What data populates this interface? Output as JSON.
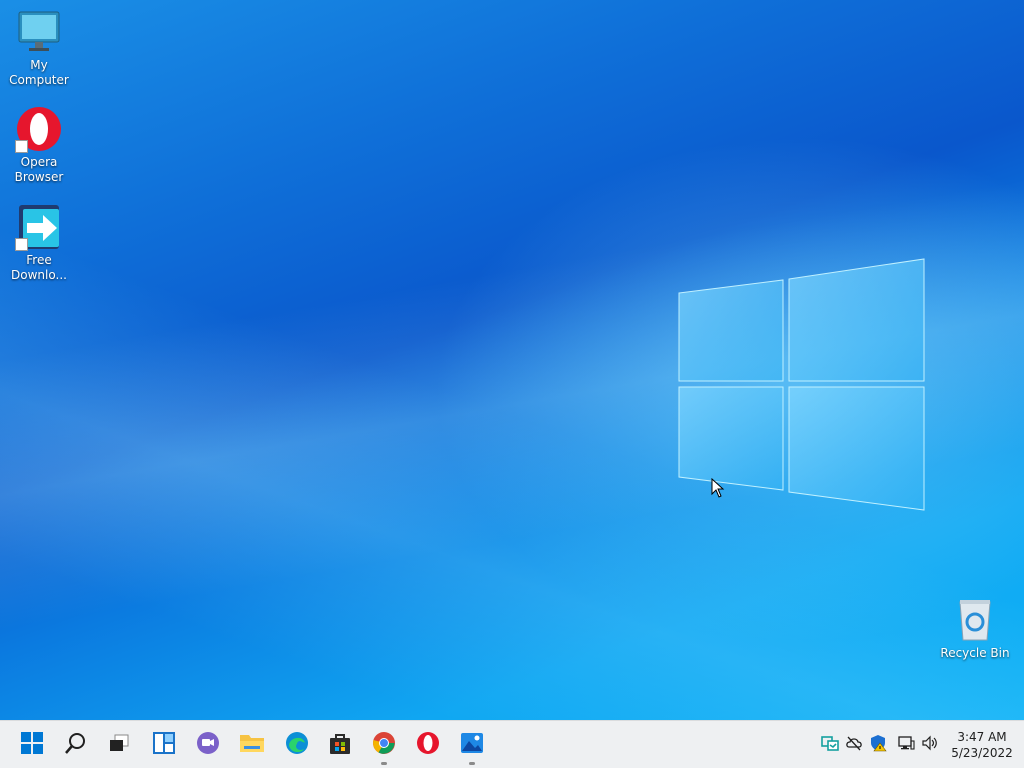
{
  "desktop": {
    "icons": [
      {
        "label": "My Computer",
        "icon": "computer-icon"
      },
      {
        "label": "Opera Browser",
        "icon": "opera-icon"
      },
      {
        "label": "Free Downlo...",
        "icon": "free-download-manager-icon"
      },
      {
        "label": "Recycle Bin",
        "icon": "recycle-bin-icon"
      }
    ]
  },
  "taskbar": {
    "apps": [
      {
        "name": "start",
        "icon": "windows-start-icon"
      },
      {
        "name": "search",
        "icon": "search-icon"
      },
      {
        "name": "task-view",
        "icon": "task-view-icon"
      },
      {
        "name": "widgets",
        "icon": "widgets-icon"
      },
      {
        "name": "chat",
        "icon": "teams-chat-icon"
      },
      {
        "name": "file-explorer",
        "icon": "folder-icon"
      },
      {
        "name": "edge",
        "icon": "edge-icon"
      },
      {
        "name": "store",
        "icon": "store-icon"
      },
      {
        "name": "chrome",
        "icon": "chrome-icon",
        "running": true
      },
      {
        "name": "opera",
        "icon": "opera-icon"
      },
      {
        "name": "photos",
        "icon": "photos-icon",
        "running": true
      }
    ],
    "tray": [
      "sync-icon",
      "cloud-offline-icon",
      "security-warning-icon",
      "network-icon",
      "volume-icon"
    ],
    "clock": {
      "time": "3:47 AM",
      "date": "5/23/2022"
    }
  },
  "colors": {
    "accent": "#0078d4",
    "taskbar_bg": "#eef0f2"
  }
}
